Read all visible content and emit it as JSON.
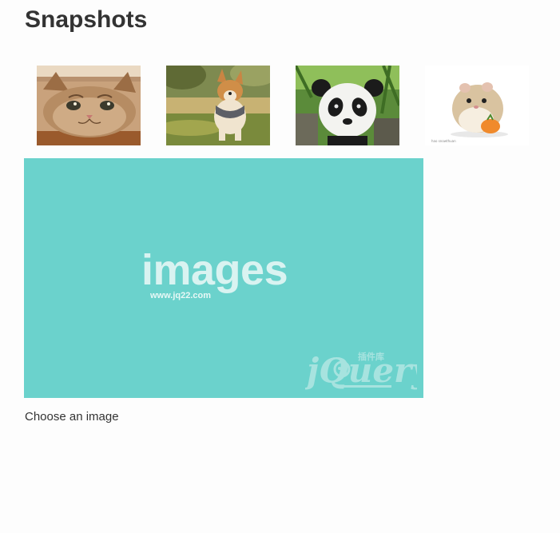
{
  "heading": "Snapshots",
  "thumbnails": [
    {
      "name": "cat"
    },
    {
      "name": "corgi"
    },
    {
      "name": "panda"
    },
    {
      "name": "hamster",
      "watermark": "hao snowthuan"
    }
  ],
  "preview": {
    "big_text": "images",
    "sub_text": "www.jq22.com",
    "logo_text": "jQuery",
    "logo_cn": "插件库",
    "background_color": "#6bd2cc"
  },
  "caption": "Choose an image"
}
